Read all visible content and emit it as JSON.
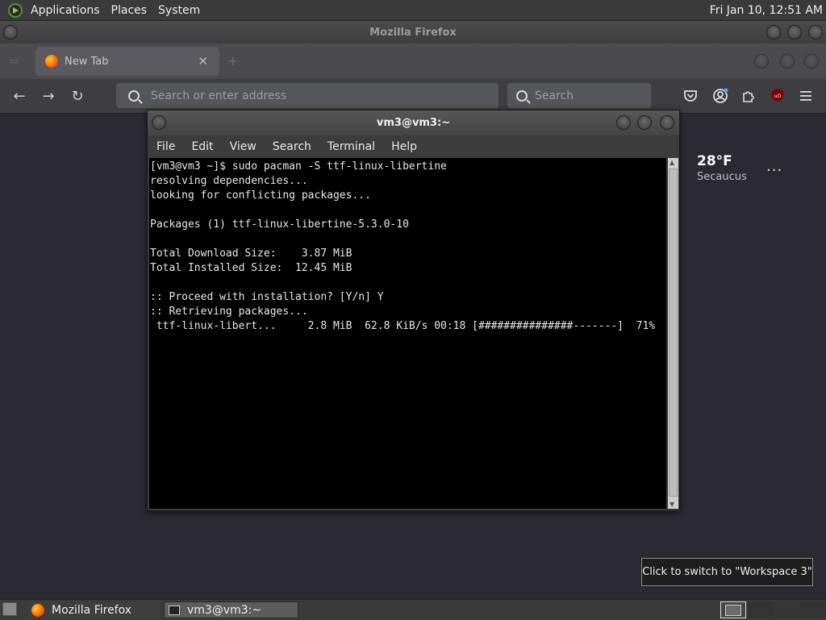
{
  "top_panel": {
    "menus": [
      "Applications",
      "Places",
      "System"
    ],
    "clock": "Fri Jan 10, 12:51 AM"
  },
  "firefox": {
    "window_title": "Mozilla Firefox",
    "tab": {
      "label": "New Tab"
    },
    "url_placeholder": "Search or enter address",
    "search_placeholder": "Search",
    "weather": {
      "temperature": "28°F",
      "location": "Secaucus",
      "more": "..."
    }
  },
  "terminal": {
    "title": "vm3@vm3:~",
    "menus": [
      "File",
      "Edit",
      "View",
      "Search",
      "Terminal",
      "Help"
    ],
    "output": "[vm3@vm3 ~]$ sudo pacman -S ttf-linux-libertine\nresolving dependencies...\nlooking for conflicting packages...\n\nPackages (1) ttf-linux-libertine-5.3.0-10\n\nTotal Download Size:    3.87 MiB\nTotal Installed Size:  12.45 MiB\n\n:: Proceed with installation? [Y/n] Y\n:: Retrieving packages...\n ttf-linux-libert...     2.8 MiB  62.8 KiB/s 00:18 [###############-------]  71%"
  },
  "tooltip": "Click to switch to \"Workspace 3\"",
  "taskbar": {
    "tasks": [
      {
        "label": "Mozilla Firefox"
      },
      {
        "label": "vm3@vm3:~"
      }
    ]
  }
}
